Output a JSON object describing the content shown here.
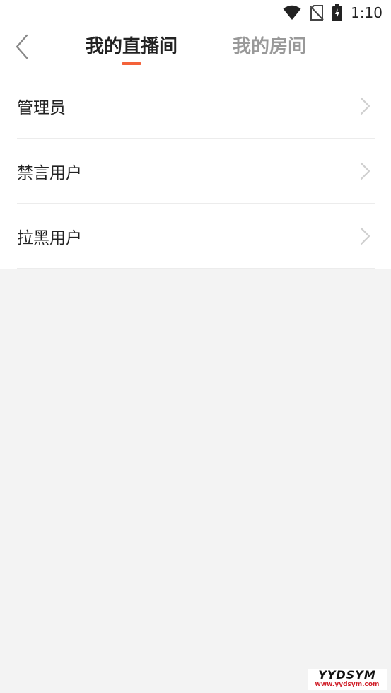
{
  "status_bar": {
    "time": "1:10",
    "icons": [
      "wifi-icon",
      "no-sim-icon",
      "battery-charging-icon"
    ]
  },
  "header": {
    "back_icon": "chevron-left-icon",
    "tabs": [
      {
        "label": "我的直播间",
        "active": true
      },
      {
        "label": "我的房间",
        "active": false
      }
    ],
    "indicator_color": "#f4623a"
  },
  "menu": {
    "items": [
      {
        "label": "管理员",
        "icon": "chevron-right-icon"
      },
      {
        "label": "禁言用户",
        "icon": "chevron-right-icon"
      },
      {
        "label": "拉黑用户",
        "icon": "chevron-right-icon"
      }
    ]
  },
  "watermark": {
    "main": "YYDSYM",
    "sub": "www.yydsym.com"
  }
}
